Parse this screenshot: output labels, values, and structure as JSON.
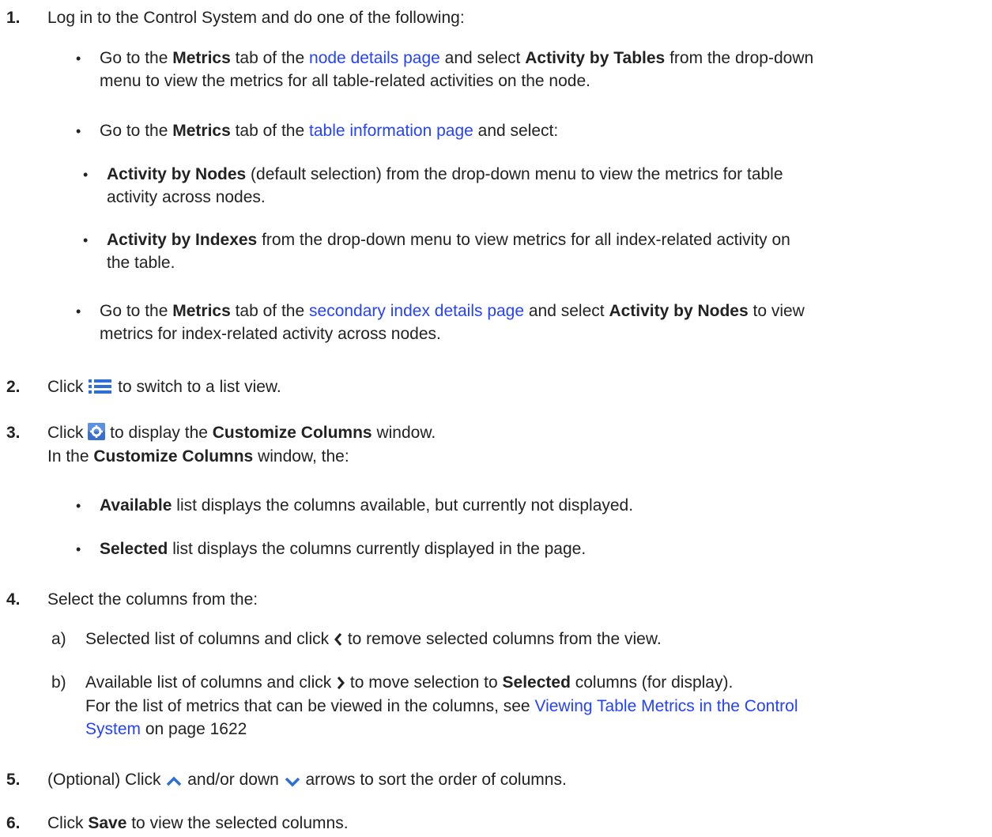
{
  "s1": {
    "num": "1.",
    "text": "Log in to the Control System and do one of the following:",
    "b1": {
      "t1": "Go to the ",
      "bold1": "Metrics",
      "t2": " tab of the ",
      "link": "node details page",
      "t3": " and select ",
      "bold2": "Activity by Tables",
      "t4": " from the drop-down",
      "line2": "menu to view the metrics for all table-related activities on the node."
    },
    "b2": {
      "t1": "Go to the ",
      "bold1": "Metrics",
      "t2": " tab of the ",
      "link": "table information page",
      "t3": " and select:",
      "sub1": {
        "bold": "Activity by Nodes",
        "t1": " (default selection) from the drop-down menu to view the metrics for table",
        "line2": "activity across nodes."
      },
      "sub2": {
        "bold": "Activity by Indexes",
        "t1": " from the drop-down menu to view metrics for all index-related activity on",
        "line2": "the table."
      }
    },
    "b3": {
      "t1": "Go to the ",
      "bold1": "Metrics",
      "t2": " tab of the ",
      "link": "secondary index details page",
      "t3": " and select ",
      "bold2": "Activity by Nodes",
      "t4": " to view",
      "line2": "metrics for index-related activity across nodes."
    }
  },
  "s2": {
    "num": "2.",
    "t1": "Click ",
    "icon": "list-view-icon",
    "t2": " to switch to a list view."
  },
  "s3": {
    "num": "3.",
    "t1": "Click ",
    "icon": "gear-icon",
    "t2": " to display the ",
    "bold": "Customize Columns",
    "t3": " window.",
    "l2a": "In the ",
    "l2bold": "Customize Columns",
    "l2b": " window, the:",
    "b1": {
      "bold": "Available",
      "t": " list displays the columns available, but currently not displayed."
    },
    "b2": {
      "bold": "Selected",
      "t": " list displays the columns currently displayed in the page."
    }
  },
  "s4": {
    "num": "4.",
    "text": "Select the columns from the:",
    "a": {
      "label": "a)",
      "t1": "Selected list of columns and click ",
      "icon": "chevron-left-icon",
      "t2": " to remove selected columns from the view."
    },
    "b": {
      "label": "b)",
      "t1": "Available list of columns and click ",
      "icon": "chevron-right-icon",
      "t2": " to move selection to ",
      "bold": "Selected",
      "t3": " columns (for display).",
      "l2a": "For the list of metrics that can be viewed in the columns, see ",
      "l2link": "Viewing Table Metrics in the Control",
      "l3link": "System",
      "l3b": " on page 1622"
    }
  },
  "s5": {
    "num": "5.",
    "t1": "(Optional) Click ",
    "icon1": "chevron-up-icon",
    "t2": " and/or down ",
    "icon2": "chevron-down-icon",
    "t3": " arrows to sort the order of columns."
  },
  "s6": {
    "num": "6.",
    "t1": "Click ",
    "bold": "Save",
    "t2": " to view the selected columns."
  },
  "bullet_char": "•",
  "colors": {
    "link": "#2442ff",
    "text": "#222222",
    "icon_blue": "#3a6fd0"
  }
}
